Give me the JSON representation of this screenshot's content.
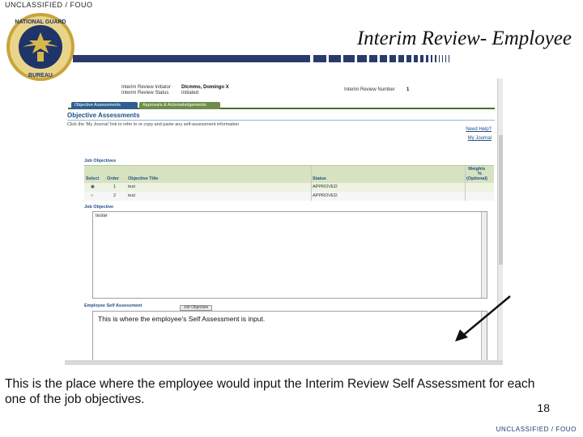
{
  "classification_top": "UNCLASSIFIED / FOUO",
  "classification_bottom": "UNCLASSIFIED / FOUO",
  "slide_title": "Interim Review- Employee",
  "logo": {
    "icon": "national-guard-bureau-seal",
    "text": "NATIONAL GUARD BUREAU"
  },
  "app": {
    "initiator_label": "Interim Review Initiator",
    "initiator_value": "Dlcmmo, Domingo X",
    "status_label": "Interim Review Status",
    "status_value": "Initiated",
    "number_label": "Interim Review Number",
    "number_value": "1",
    "tabs": [
      "Objective Assessments",
      "Approvals & Acknowledgements"
    ],
    "section_title": "Objective Assessments",
    "section_desc": "Click the 'My Journal' link to refer to or copy and paste any self-assessment information",
    "links": {
      "help": "Need Help?",
      "journal": "My Journal"
    },
    "job_objectives_label": "Job Objectives",
    "columns": {
      "select": "Select",
      "order": "Order",
      "title": "Objective Title",
      "status": "Status",
      "weight_1": "Weights",
      "weight_2": "%",
      "weight_3": "(Optional)"
    },
    "rows": [
      {
        "order": "1",
        "title": "test",
        "status": "APPROVED",
        "selected": true
      },
      {
        "order": "2",
        "title": "test",
        "status": "APPROVED",
        "selected": false
      }
    ],
    "job_objective_label": "Job Objective",
    "job_objective_text": "tester",
    "self_assessment_label": "Employee Self Assessment",
    "small_button": "Job Objective",
    "self_assessment_text": "This is where the employee's Self Assessment is input."
  },
  "caption": "This is the place where the employee would input the Interim Review Self Assessment for each one of the job objectives.",
  "page_number": "18",
  "colors": {
    "band": "#2a3b6b",
    "tab_active": "#2f5f8f",
    "tab_inactive": "#6e8c4a",
    "table_head": "#d7e2c0",
    "link": "#1e4f86"
  }
}
